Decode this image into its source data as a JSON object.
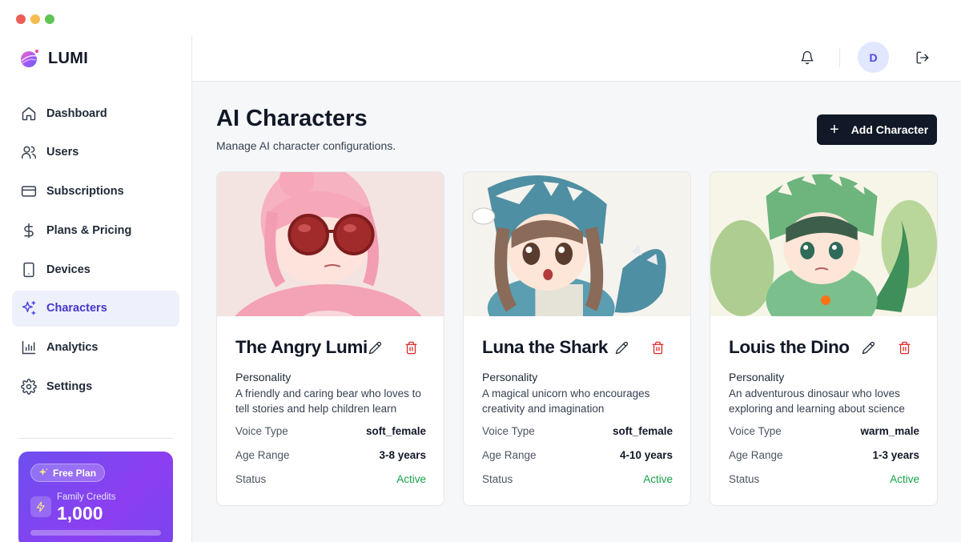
{
  "app": {
    "name": "LUMI"
  },
  "sidebar": {
    "items": [
      {
        "label": "Dashboard",
        "icon": "home-icon",
        "active": false
      },
      {
        "label": "Users",
        "icon": "users-icon",
        "active": false
      },
      {
        "label": "Subscriptions",
        "icon": "credit-card-icon",
        "active": false
      },
      {
        "label": "Plans & Pricing",
        "icon": "dollar-icon",
        "active": false
      },
      {
        "label": "Devices",
        "icon": "tablet-icon",
        "active": false
      },
      {
        "label": "Characters",
        "icon": "sparkles-icon",
        "active": true
      },
      {
        "label": "Analytics",
        "icon": "bar-chart-icon",
        "active": false
      },
      {
        "label": "Settings",
        "icon": "gear-icon",
        "active": false
      }
    ],
    "plan": {
      "badge": "Free Plan",
      "credits_label": "Family Credits",
      "credits_value": "1,000"
    }
  },
  "topbar": {
    "avatar_initial": "D"
  },
  "page": {
    "title": "AI Characters",
    "subtitle": "Manage AI character configurations.",
    "add_button": "Add Character"
  },
  "labels": {
    "personality": "Personality",
    "voice_type": "Voice Type",
    "age_range": "Age Range",
    "status": "Status"
  },
  "characters": [
    {
      "name": "The Angry Lumi",
      "personality": "A friendly and caring bear who loves to tell stories and help children learn",
      "voice_type": "soft_female",
      "age_range": "3-8 years",
      "status": "Active"
    },
    {
      "name": "Luna the Shark",
      "personality": "A magical unicorn who encourages creativity and imagination",
      "voice_type": "soft_female",
      "age_range": "4-10 years",
      "status": "Active"
    },
    {
      "name": "Louis the Dino",
      "personality": "An adventurous dinosaur who loves exploring and learning about science",
      "voice_type": "warm_male",
      "age_range": "1-3 years",
      "status": "Active"
    }
  ],
  "colors": {
    "accent": "#4f46e5",
    "active_nav_bg": "#eef0fb",
    "status_active": "#16a34a",
    "delete": "#dc2626",
    "primary_button": "#111827"
  }
}
